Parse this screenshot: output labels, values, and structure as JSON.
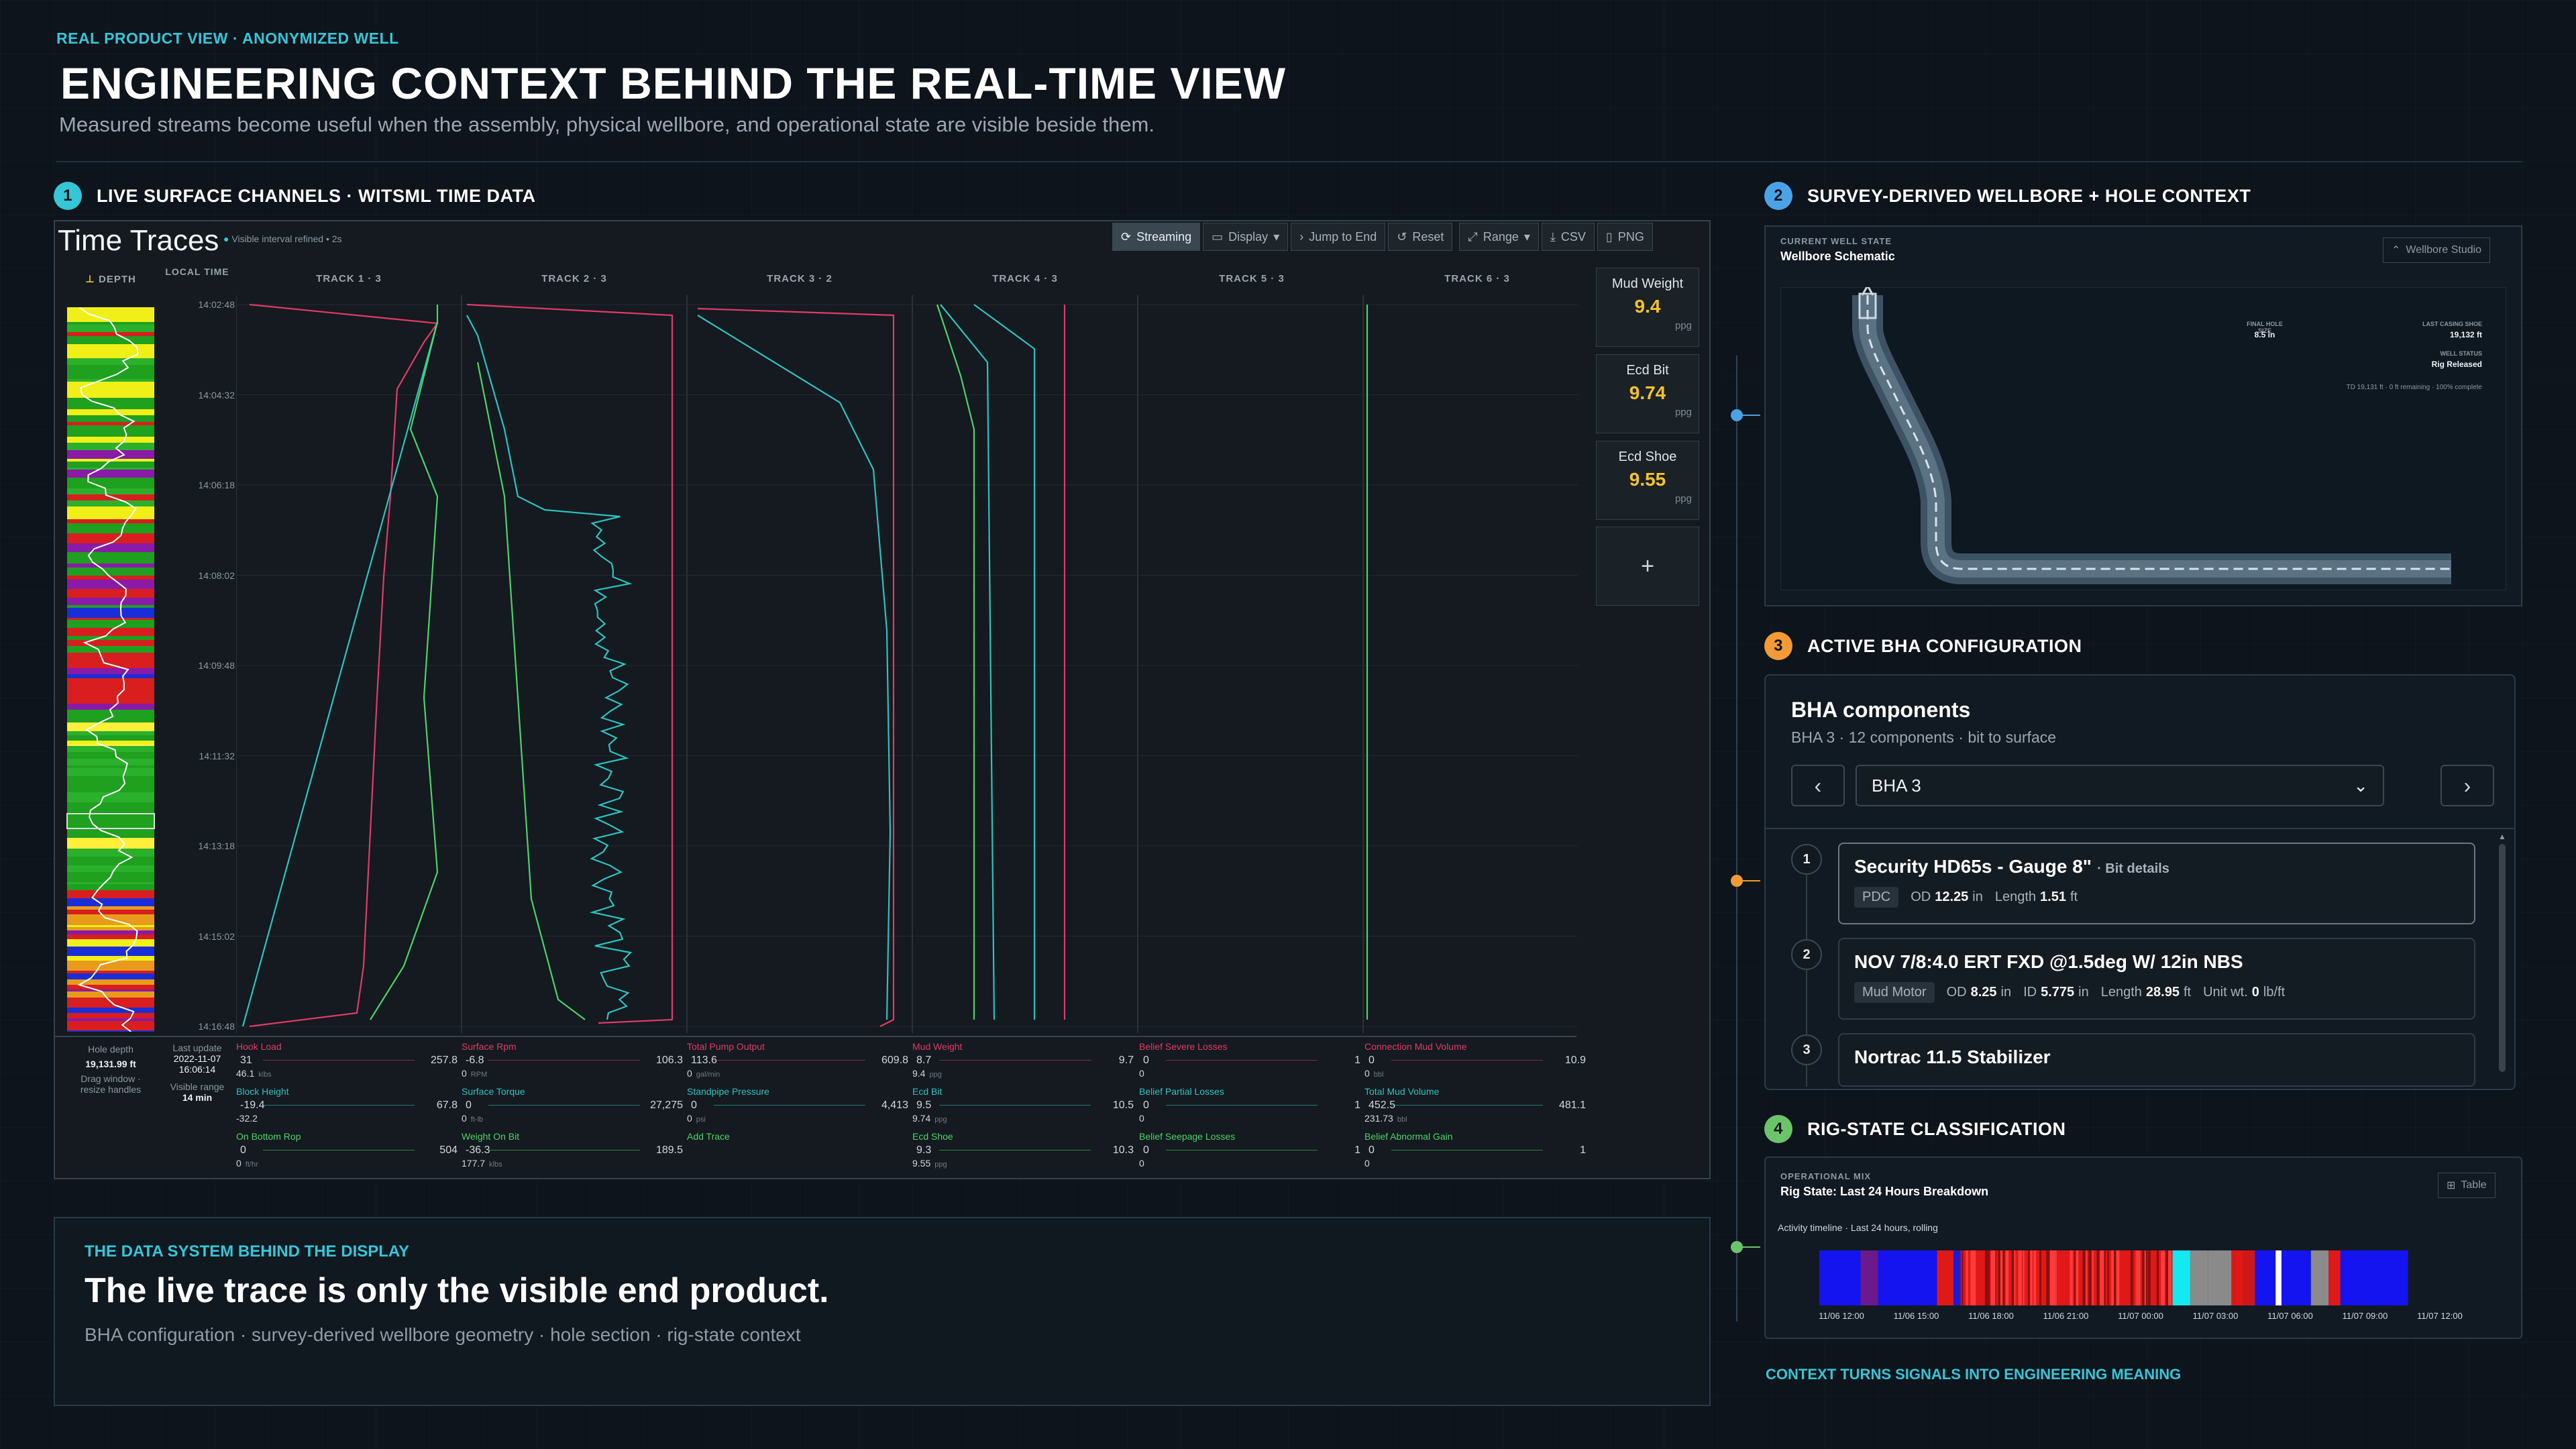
{
  "header": {
    "kicker": "REAL PRODUCT VIEW · ANONYMIZED WELL",
    "title": "ENGINEERING CONTEXT BEHIND THE REAL-TIME VIEW",
    "subtitle": "Measured streams become useful when the assembly, physical wellbore, and operational state are visible beside them."
  },
  "sections": {
    "s1": {
      "num": "1",
      "label": "LIVE SURFACE CHANNELS · WITSML TIME DATA",
      "color": "#35c6d8"
    },
    "s2": {
      "num": "2",
      "label": "SURVEY-DERIVED WELLBORE + HOLE CONTEXT",
      "color": "#4aa3e6"
    },
    "s3": {
      "num": "3",
      "label": "ACTIVE BHA CONFIGURATION",
      "color": "#f39a36"
    },
    "s4": {
      "num": "4",
      "label": "RIG-STATE CLASSIFICATION",
      "color": "#6cc46a"
    }
  },
  "time_traces": {
    "title": "Time Traces",
    "note": "Visible interval refined • 2s",
    "toolbar": {
      "streaming": "Streaming",
      "display": "Display",
      "jump": "Jump to End",
      "reset": "Reset",
      "range": "Range",
      "csv": "CSV",
      "png": "PNG"
    },
    "depth_label": "DEPTH",
    "local_time_label": "LOCAL TIME",
    "tracks": [
      "TRACK 1 · 3",
      "TRACK 2 · 3",
      "TRACK 3 · 2",
      "TRACK 4 · 3",
      "TRACK 5 · 3",
      "TRACK 6 · 3"
    ],
    "times": [
      "14:02:48",
      "14:04:32",
      "14:06:18",
      "14:08:02",
      "14:09:48",
      "14:11:32",
      "14:13:18",
      "14:15:02",
      "14:16:48"
    ],
    "cards": [
      {
        "label": "Mud Weight",
        "value": "9.4",
        "unit": "ppg"
      },
      {
        "label": "Ecd Bit",
        "value": "9.74",
        "unit": "ppg"
      },
      {
        "label": "Ecd Shoe",
        "value": "9.55",
        "unit": "ppg"
      }
    ],
    "add_label": "+",
    "footer_left": {
      "hole_depth_label": "Hole depth",
      "hole_depth": "19,131.99 ft",
      "drag_hint": "Drag window ·",
      "drag_hint2": "resize handles",
      "last_update_label": "Last update",
      "last_update_date": "2022-11-07",
      "last_update_time": "16:06:14",
      "visible_range_label": "Visible range",
      "visible_range": "14 min"
    },
    "footer_tracks": [
      [
        {
          "name": "Hook Load",
          "min": "31",
          "max": "257.8",
          "value": "46.1",
          "unit": "klbs",
          "color": "#e23a6b"
        },
        {
          "name": "Block Height",
          "min": "-19.4",
          "max": "67.8",
          "value": "-32.2",
          "unit": "",
          "color": "#2cc2c2"
        },
        {
          "name": "On Bottom Rop",
          "min": "0",
          "max": "504",
          "value": "0",
          "unit": "ft/hr",
          "color": "#4bd36a"
        }
      ],
      [
        {
          "name": "Surface Rpm",
          "min": "-6.8",
          "max": "106.3",
          "value": "0",
          "unit": "RPM",
          "color": "#e23a6b"
        },
        {
          "name": "Surface Torque",
          "min": "0",
          "max": "27,275",
          "value": "0",
          "unit": "ft-lb",
          "color": "#2cc2c2"
        },
        {
          "name": "Weight On Bit",
          "min": "-36.3",
          "max": "189.5",
          "value": "177.7",
          "unit": "klbs",
          "color": "#4bd36a"
        }
      ],
      [
        {
          "name": "Total Pump Output",
          "min": "113.6",
          "max": "609.8",
          "value": "0",
          "unit": "gal/min",
          "color": "#e23a6b"
        },
        {
          "name": "Standpipe Pressure",
          "min": "0",
          "max": "4,413",
          "value": "0",
          "unit": "psi",
          "color": "#2cc2c2"
        },
        {
          "name": "Add Trace",
          "min": "",
          "max": "",
          "value": "",
          "unit": "",
          "color": "#4bd36a"
        }
      ],
      [
        {
          "name": "Mud Weight",
          "min": "8.7",
          "max": "9.7",
          "value": "9.4",
          "unit": "ppg",
          "color": "#e23a6b"
        },
        {
          "name": "Ecd Bit",
          "min": "9.5",
          "max": "10.5",
          "value": "9.74",
          "unit": "ppg",
          "color": "#2cc2c2"
        },
        {
          "name": "Ecd Shoe",
          "min": "9.3",
          "max": "10.3",
          "value": "9.55",
          "unit": "ppg",
          "color": "#4bd36a"
        }
      ],
      [
        {
          "name": "Belief Severe Losses",
          "min": "0",
          "max": "1",
          "value": "0",
          "unit": "",
          "color": "#e23a6b"
        },
        {
          "name": "Belief Partial Losses",
          "min": "0",
          "max": "1",
          "value": "0",
          "unit": "",
          "color": "#2cc2c2"
        },
        {
          "name": "Belief Seepage Losses",
          "min": "0",
          "max": "1",
          "value": "0",
          "unit": "",
          "color": "#4bd36a"
        }
      ],
      [
        {
          "name": "Connection Mud Volume",
          "min": "0",
          "max": "10.9",
          "value": "0",
          "unit": "bbl",
          "color": "#e23a6b"
        },
        {
          "name": "Total Mud Volume",
          "min": "452.5",
          "max": "481.1",
          "value": "231.73",
          "unit": "bbl",
          "color": "#2cc2c2"
        },
        {
          "name": "Belief Abnormal Gain",
          "min": "0",
          "max": "1",
          "value": "0",
          "unit": "",
          "color": "#4bd36a"
        }
      ]
    ]
  },
  "data_system": {
    "kicker": "THE DATA SYSTEM BEHIND THE DISPLAY",
    "headline": "The live trace is only the visible end product.",
    "items": "BHA configuration · survey-derived wellbore geometry · hole section · rig-state context"
  },
  "wellbore": {
    "kicker": "CURRENT WELL STATE",
    "title": "Wellbore Schematic",
    "button": "Wellbore Studio",
    "final_hole_label": "FINAL HOLE SIZE",
    "final_hole": "8.5 in",
    "last_shoe_label": "LAST CASING SHOE",
    "last_shoe": "19,132 ft",
    "status_label": "WELL STATUS",
    "status": "Rig Released",
    "td_note": "TD 19,131 ft · 0 ft remaining · 100% complete"
  },
  "bha": {
    "title": "BHA components",
    "subtitle": "BHA 3 · 12 components · bit to surface",
    "selected": "BHA 3",
    "components": [
      {
        "index": "1",
        "name": "Security HD65s - Gauge 8\"",
        "suffix": "· Bit details",
        "type": "PDC",
        "specs": [
          {
            "k": "OD",
            "v": "12.25",
            "u": "in"
          },
          {
            "k": "Length",
            "v": "1.51",
            "u": "ft"
          }
        ]
      },
      {
        "index": "2",
        "name": "NOV 7/8:4.0 ERT FXD @1.5deg W/ 12in NBS",
        "suffix": "",
        "type": "Mud Motor",
        "specs": [
          {
            "k": "OD",
            "v": "8.25",
            "u": "in"
          },
          {
            "k": "ID",
            "v": "5.775",
            "u": "in"
          },
          {
            "k": "Length",
            "v": "28.95",
            "u": "ft"
          },
          {
            "k": "Unit wt.",
            "v": "0",
            "u": "lb/ft"
          }
        ]
      },
      {
        "index": "3",
        "name": "Nortrac 11.5 Stabilizer",
        "suffix": "",
        "type": "",
        "specs": []
      }
    ]
  },
  "rig_state": {
    "kicker": "OPERATIONAL MIX",
    "title": "Rig State: Last 24 Hours Breakdown",
    "button": "Table",
    "timeline_label": "Activity timeline · Last 24 hours, rolling",
    "ticks": [
      "11/06 12:00",
      "11/06 15:00",
      "11/06 18:00",
      "11/06 21:00",
      "11/07 00:00",
      "11/07 03:00",
      "11/07 06:00",
      "11/07 09:00",
      "11/07 12:00"
    ],
    "footer": "CONTEXT TURNS SIGNALS INTO ENGINEERING MEANING"
  },
  "colors": {
    "accent": "#35c6d8",
    "trace_red": "#e23a6b",
    "trace_teal": "#2cc2c2",
    "trace_green": "#4bd36a",
    "card_value": "#f4c22c"
  }
}
